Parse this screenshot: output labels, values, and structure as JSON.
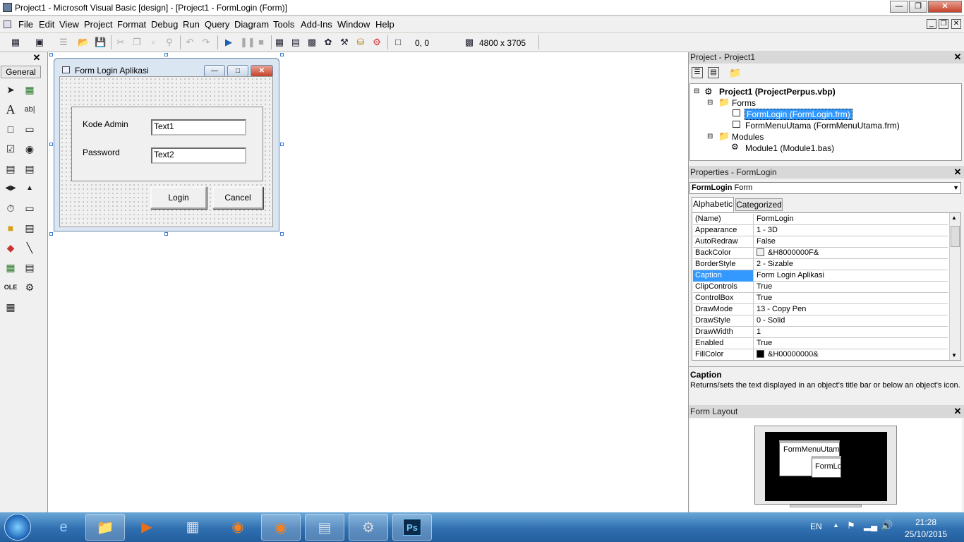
{
  "window": {
    "title": "Project1 - Microsoft Visual Basic [design] - [Project1 - FormLogin (Form)]"
  },
  "menus": [
    "File",
    "Edit",
    "View",
    "Project",
    "Format",
    "Debug",
    "Run",
    "Query",
    "Diagram",
    "Tools",
    "Add-Ins",
    "Window",
    "Help"
  ],
  "toolbar": {
    "coords": "0, 0",
    "size": "4800 x 3705"
  },
  "toolbox": {
    "tab_label": "General"
  },
  "form": {
    "caption": "Form Login Aplikasi",
    "label_kode": "Kode Admin",
    "label_password": "Password",
    "text1": "Text1",
    "text2": "Text2",
    "login_label": "Login",
    "cancel_label": "Cancel"
  },
  "project": {
    "header": "Project - Project1",
    "root": "Project1 (ProjectPerpus.vbp)",
    "forms_folder": "Forms",
    "form1": "FormLogin (FormLogin.frm)",
    "form2": "FormMenuUtama (FormMenuUtama.frm)",
    "modules_folder": "Modules",
    "module1": "Module1 (Module1.bas)"
  },
  "properties": {
    "header": "Properties - FormLogin",
    "object_name": "FormLogin",
    "object_type": "Form",
    "tab_alpha": "Alphabetic",
    "tab_cat": "Categorized",
    "rows": [
      {
        "name": "(Name)",
        "value": "FormLogin"
      },
      {
        "name": "Appearance",
        "value": "1 - 3D"
      },
      {
        "name": "AutoRedraw",
        "value": "False"
      },
      {
        "name": "BackColor",
        "value": "&H8000000F&"
      },
      {
        "name": "BorderStyle",
        "value": "2 - Sizable"
      },
      {
        "name": "Caption",
        "value": "Form Login Aplikasi"
      },
      {
        "name": "ClipControls",
        "value": "True"
      },
      {
        "name": "ControlBox",
        "value": "True"
      },
      {
        "name": "DrawMode",
        "value": "13 - Copy Pen"
      },
      {
        "name": "DrawStyle",
        "value": "0 - Solid"
      },
      {
        "name": "DrawWidth",
        "value": "1"
      },
      {
        "name": "Enabled",
        "value": "True"
      },
      {
        "name": "FillColor",
        "value": "&H00000000&"
      }
    ],
    "desc_title": "Caption",
    "desc_text": "Returns/sets the text displayed in an object's title bar or below an object's icon."
  },
  "form_layout": {
    "header": "Form Layout",
    "label1": "FormMenuUtam",
    "label2": "FormLo"
  },
  "taskbar": {
    "lang": "EN",
    "time": "21:28",
    "date": "25/10/2015",
    "ps_label": "Ps"
  },
  "colors": {
    "selection": "#3399ff",
    "taskbar": "#2f6fb0"
  }
}
